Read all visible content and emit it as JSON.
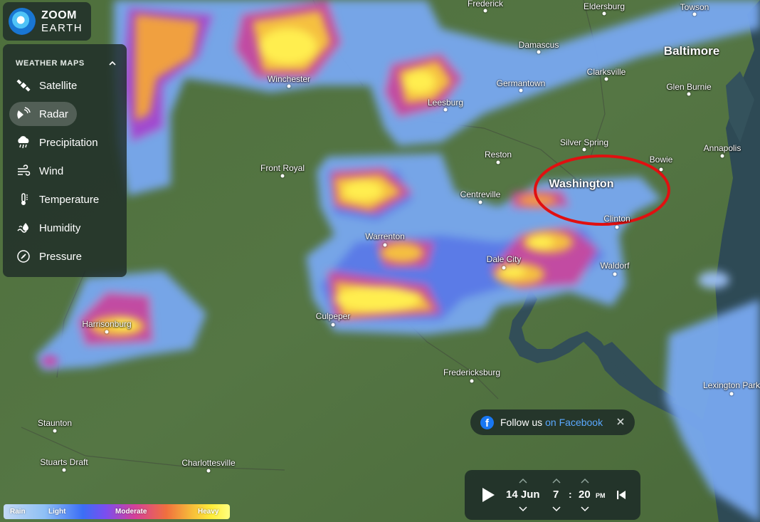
{
  "app": {
    "logo_line1": "ZOOM",
    "logo_line2": "EARTH"
  },
  "sidebar": {
    "header": "WEATHER MAPS",
    "items": [
      {
        "label": "Satellite",
        "icon": "satellite-icon",
        "active": false
      },
      {
        "label": "Radar",
        "icon": "radar-icon",
        "active": true
      },
      {
        "label": "Precipitation",
        "icon": "precipitation-icon",
        "active": false
      },
      {
        "label": "Wind",
        "icon": "wind-icon",
        "active": false
      },
      {
        "label": "Temperature",
        "icon": "thermometer-icon",
        "active": false
      },
      {
        "label": "Humidity",
        "icon": "humidity-icon",
        "active": false
      },
      {
        "label": "Pressure",
        "icon": "pressure-icon",
        "active": false
      }
    ]
  },
  "map": {
    "cities": [
      {
        "name": "Frederick"
      },
      {
        "name": "Eldersburg"
      },
      {
        "name": "Towson"
      },
      {
        "name": "Damascus"
      },
      {
        "name": "Baltimore"
      },
      {
        "name": "Clarksville"
      },
      {
        "name": "Winchester"
      },
      {
        "name": "Germantown"
      },
      {
        "name": "Glen Burnie"
      },
      {
        "name": "Leesburg"
      },
      {
        "name": "Silver Spring"
      },
      {
        "name": "Reston"
      },
      {
        "name": "Annapolis"
      },
      {
        "name": "Bowie"
      },
      {
        "name": "Front Royal"
      },
      {
        "name": "Washington"
      },
      {
        "name": "Centreville"
      },
      {
        "name": "Clinton"
      },
      {
        "name": "Warrenton"
      },
      {
        "name": "Dale City"
      },
      {
        "name": "Waldorf"
      },
      {
        "name": "Culpeper"
      },
      {
        "name": "Harrisonburg"
      },
      {
        "name": "Fredericksburg"
      },
      {
        "name": "Lexington Park"
      },
      {
        "name": "Staunton"
      },
      {
        "name": "Stuarts Draft"
      },
      {
        "name": "Charlottesville"
      }
    ],
    "highlight_color": "#e01010"
  },
  "facebook": {
    "text": "Follow us",
    "link": "on Facebook"
  },
  "timebar": {
    "date": "14 Jun",
    "hour": "7",
    "minute": "20",
    "ampm": "PM",
    "separator": ":"
  },
  "legend": {
    "rain": "Rain",
    "light": "Light",
    "moderate": "Moderate",
    "heavy": "Heavy"
  }
}
